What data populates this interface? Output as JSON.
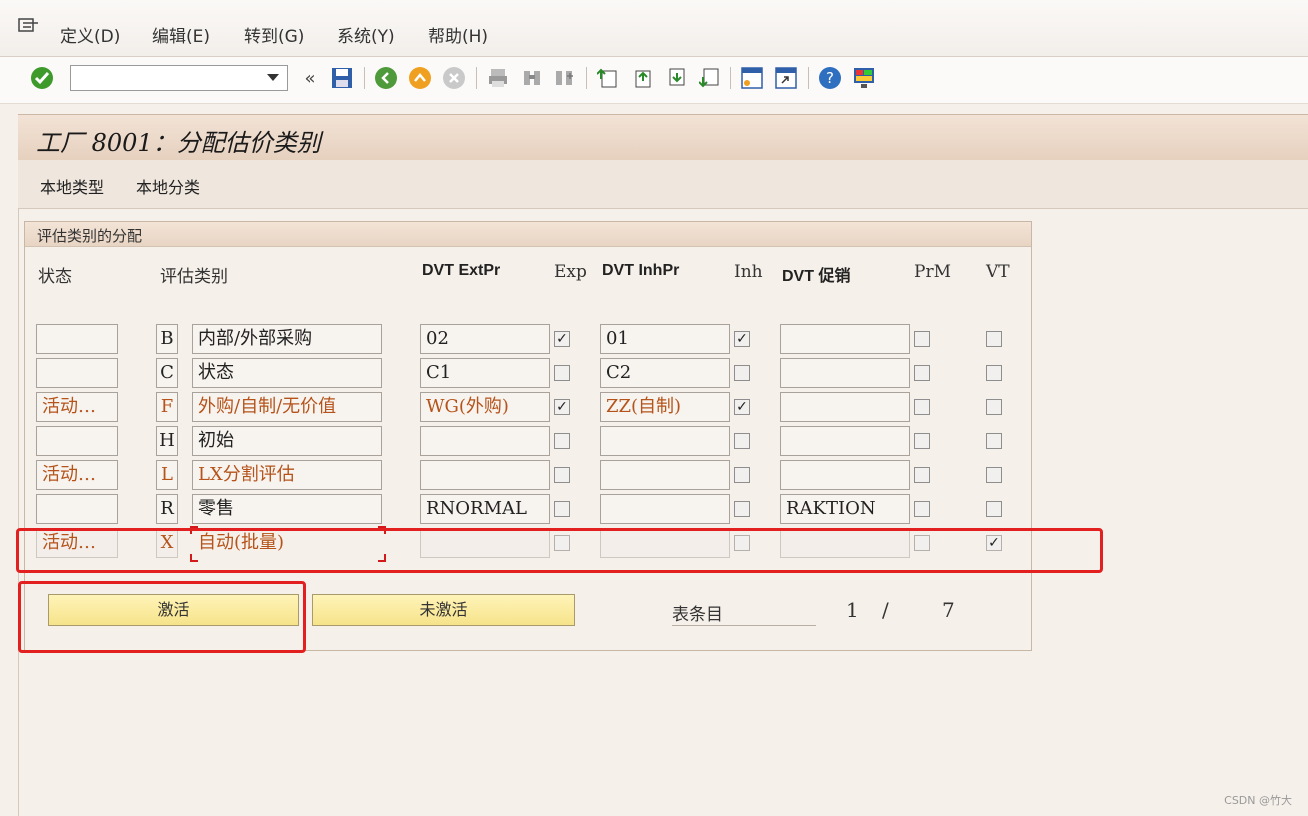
{
  "menu": {
    "items": [
      "定义(D)",
      "编辑(E)",
      "转到(G)",
      "系统(Y)",
      "帮助(H)"
    ]
  },
  "toolbar": {
    "command_value": "",
    "double_arrow": "«"
  },
  "title": "工厂 8001：分配估价类别",
  "appbar": {
    "buttons": [
      "本地类型",
      "本地分类"
    ]
  },
  "group": {
    "title": "评估类别的分配"
  },
  "columns": {
    "status": "状态",
    "valclass": "评估类别",
    "dvt_extpr": "DVT ExtPr",
    "exp": "Exp",
    "dvt_inhpr": "DVT InhPr",
    "inh": "Inh",
    "dvt_promo": "DVT 促销",
    "prm": "PrM",
    "vt": "VT"
  },
  "rows": [
    {
      "status": "",
      "code": "B",
      "desc": "内部/外部采购",
      "extpr": "02",
      "exp": true,
      "inhpr": "01",
      "inh": true,
      "promo": "",
      "prm": false,
      "vt": false,
      "highlight": false
    },
    {
      "status": "",
      "code": "C",
      "desc": "状态",
      "extpr": "C1",
      "exp": false,
      "inhpr": "C2",
      "inh": false,
      "promo": "",
      "prm": false,
      "vt": false,
      "highlight": false
    },
    {
      "status": "活动…",
      "code": "F",
      "desc": "外购/自制/无价值",
      "extpr": "WG(外购)",
      "exp": true,
      "inhpr": "ZZ(自制)",
      "inh": true,
      "promo": "",
      "prm": false,
      "vt": false,
      "highlight": true
    },
    {
      "status": "",
      "code": "H",
      "desc": "初始",
      "extpr": "",
      "exp": false,
      "inhpr": "",
      "inh": false,
      "promo": "",
      "prm": false,
      "vt": false,
      "highlight": false
    },
    {
      "status": "活动…",
      "code": "L",
      "desc": "LX分割评估",
      "extpr": "",
      "exp": false,
      "inhpr": "",
      "inh": false,
      "promo": "",
      "prm": false,
      "vt": false,
      "highlight": true
    },
    {
      "status": "",
      "code": "R",
      "desc": "零售",
      "extpr": "RNORMAL",
      "exp": false,
      "inhpr": "",
      "inh": false,
      "promo": "RAKTION",
      "prm": false,
      "vt": false,
      "highlight": false
    },
    {
      "status": "活动…",
      "code": "X",
      "desc": "自动(批量)",
      "extpr": "",
      "exp": false,
      "inhpr": "",
      "inh": false,
      "promo": "",
      "prm": false,
      "vt": true,
      "highlight": true
    }
  ],
  "buttons": {
    "activate": "激活",
    "deactivate": "未激活"
  },
  "footer": {
    "table_entry_label": "表条目",
    "current": "1",
    "slash": "/",
    "total": "7"
  },
  "watermark": "CSDN @竹大",
  "colors": {
    "highlight_text": "#b5531a",
    "annotation_red": "#e32020",
    "button_yellow": "#f6e38a"
  }
}
